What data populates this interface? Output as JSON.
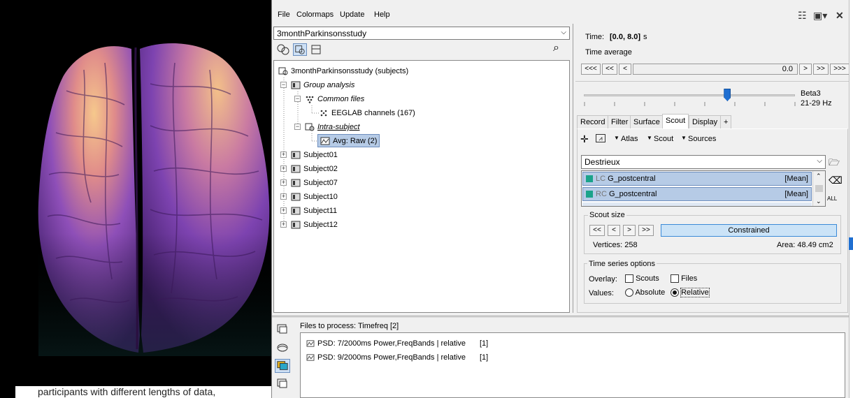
{
  "colors": {
    "accent_selection": "#b6cbe6",
    "scout_color": "#1aa38a",
    "brain_dark": "#5b2a8c",
    "brain_light": "#f2b983"
  },
  "background_text": "participants with different lengths of data,",
  "menu": {
    "file": "File",
    "colormaps": "Colormaps",
    "update": "Update",
    "help": "Help"
  },
  "protocol": {
    "name": "3monthParkinsonsstudy"
  },
  "tree": {
    "root": "3monthParkinsonsstudy (subjects)",
    "group": "Group analysis",
    "common": "Common files",
    "eeglab": "EEGLAB channels (167)",
    "intra": "Intra-subject",
    "avg": "Avg: Raw (2)",
    "subjects": [
      "Subject01",
      "Subject02",
      "Subject07",
      "Subject10",
      "Subject11",
      "Subject12"
    ]
  },
  "time": {
    "label": "Time:",
    "range": "[0.0, 8.0]",
    "unit": "s",
    "average_label": "Time average",
    "value": "0.0",
    "buttons": [
      "<<<",
      "<<",
      "<",
      ">",
      ">>",
      ">>>"
    ]
  },
  "freq": {
    "band": "Beta3",
    "range": "21-29 Hz",
    "slider_level": 0.68
  },
  "tabs": [
    "Record",
    "Filter",
    "Surface",
    "Scout",
    "Display",
    "+"
  ],
  "active_tab": "Scout",
  "scout_toolbar": {
    "atlas": "Atlas",
    "scout": "Scout",
    "sources": "Sources"
  },
  "atlas": {
    "name": "Destrieux",
    "all_label": "ALL"
  },
  "scouts": [
    {
      "hemi": "LC",
      "name": "G_postcentral",
      "func": "[Mean]"
    },
    {
      "hemi": "RC",
      "name": "G_postcentral",
      "func": "[Mean]"
    }
  ],
  "scout_size": {
    "title": "Scout size",
    "buttons": [
      "<<",
      "<",
      ">",
      ">>"
    ],
    "mode": "Constrained",
    "vertices": "Vertices: 258",
    "area": "Area: 48.49 cm2"
  },
  "ts_options": {
    "title": "Time series options",
    "overlay_label": "Overlay:",
    "scouts": "Scouts",
    "files": "Files",
    "values_label": "Values:",
    "absolute": "Absolute",
    "relative": "Relative"
  },
  "process": {
    "title": "Files to process: Timefreq [2]",
    "files": [
      {
        "name": "PSD: 7/2000ms Power,FreqBands | relative",
        "count": "[1]"
      },
      {
        "name": "PSD: 9/2000ms Power,FreqBands | relative",
        "count": "[1]"
      }
    ]
  }
}
